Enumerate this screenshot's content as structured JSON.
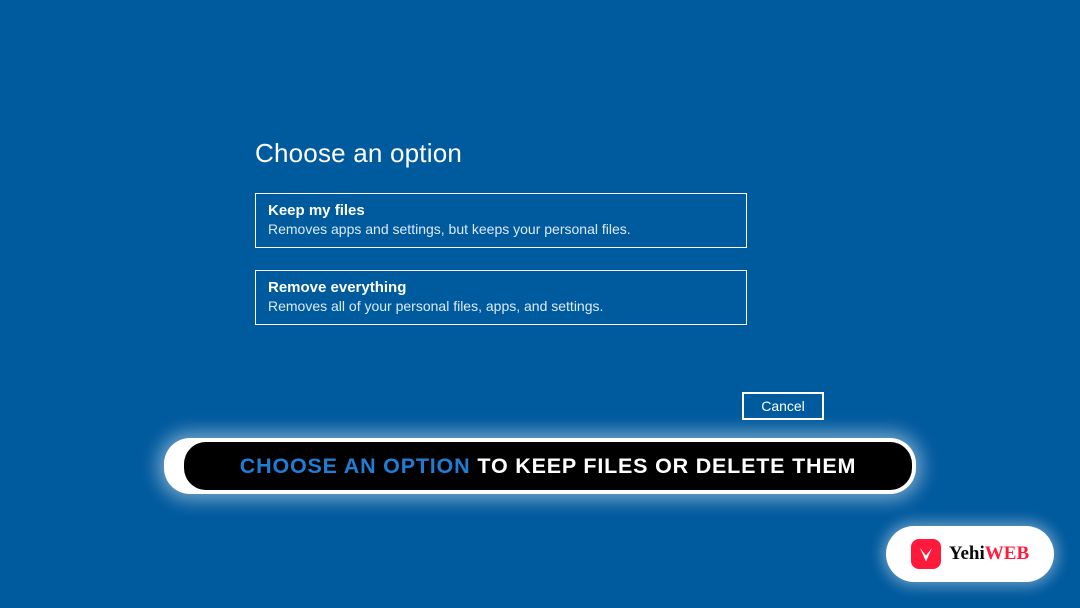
{
  "dialog": {
    "title": "Choose an option",
    "options": [
      {
        "title": "Keep my files",
        "desc": "Removes apps and settings, but keeps your personal files."
      },
      {
        "title": "Remove everything",
        "desc": "Removes all of your personal files, apps, and settings."
      }
    ],
    "cancel_label": "Cancel"
  },
  "banner": {
    "highlight": "CHOOSE AN OPTION",
    "rest": "TO KEEP FILES OR DELETE THEM"
  },
  "watermark": {
    "brand_main": "Yehi",
    "brand_accent": "WEB"
  }
}
